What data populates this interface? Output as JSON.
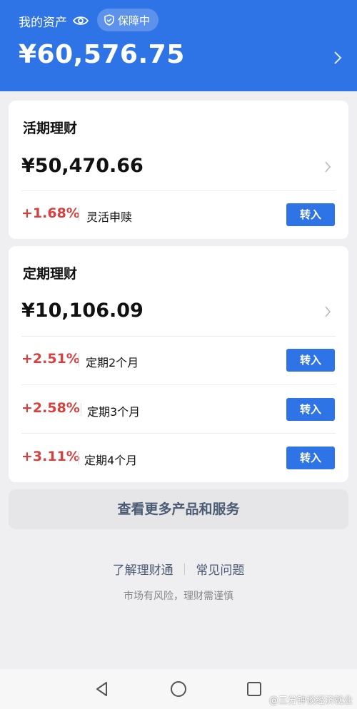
{
  "header": {
    "asset_label": "我的资产",
    "eye_icon": "eye-icon",
    "guard_label": "保障中",
    "guard_icon": "shield-check-icon",
    "total": "¥60,576.75",
    "chevron_icon": "chevron-right-icon",
    "accent_color": "#2f74e6"
  },
  "current": {
    "title": "活期理财",
    "amount": "¥50,470.66",
    "products": [
      {
        "rate": "+1.68%",
        "label": "灵活申赎",
        "button": "转入"
      }
    ]
  },
  "fixed": {
    "title": "定期理财",
    "amount": "¥10,106.09",
    "products": [
      {
        "rate": "+2.51%",
        "label": "定期2个月",
        "button": "转入"
      },
      {
        "rate": "+2.58%",
        "label": "定期3个月",
        "button": "转入"
      },
      {
        "rate": "+3.11%",
        "label": "定期4个月",
        "button": "转入"
      }
    ]
  },
  "more_button": "查看更多产品和服务",
  "footer": {
    "link_learn": "了解理财通",
    "link_faq": "常见问题",
    "risk_notice": "市场有风险，理财需谨慎"
  },
  "navbar": {
    "back_icon": "back-triangle-icon",
    "home_icon": "home-circle-icon",
    "recent_icon": "recent-square-icon"
  },
  "watermark": "@三分钟谈经济就业",
  "colors": {
    "rate_red": "#d6403e",
    "button_blue": "#2f74e6"
  }
}
